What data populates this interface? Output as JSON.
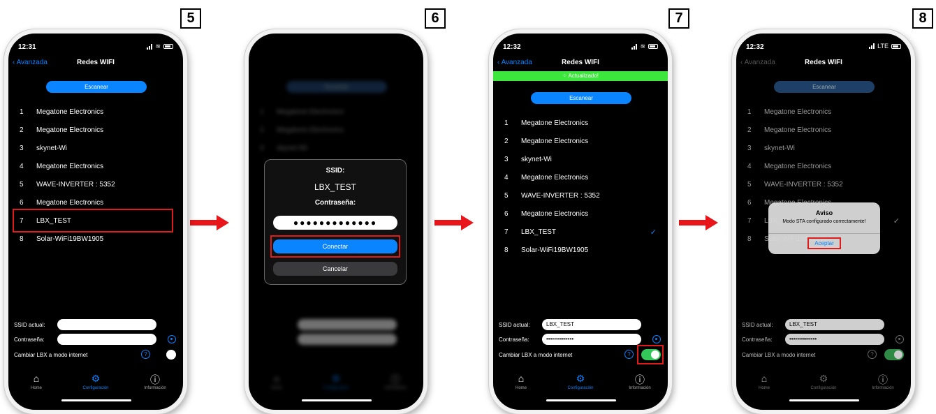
{
  "steps": [
    "5",
    "6",
    "7",
    "8"
  ],
  "status_bar": {
    "time_5": "12:31",
    "time_7": "12:32",
    "time_8": "12:32",
    "lte": "LTE"
  },
  "nav": {
    "back_label": "Avanzada",
    "title": "Redes WIFI"
  },
  "banner": {
    "text": "Actualizado!"
  },
  "scan_button": "Escanear",
  "networks": [
    {
      "num": "1",
      "name": "Megatone Electronics"
    },
    {
      "num": "2",
      "name": "Megatone Electronics"
    },
    {
      "num": "3",
      "name": "skynet-Wi"
    },
    {
      "num": "4",
      "name": "Megatone Electronics"
    },
    {
      "num": "5",
      "name": "WAVE-INVERTER : 5352"
    },
    {
      "num": "6",
      "name": "Megatone Electronics"
    },
    {
      "num": "7",
      "name": "LBX_TEST"
    },
    {
      "num": "8",
      "name": "Solar-WiFi19BW1905"
    }
  ],
  "form": {
    "ssid_label": "SSID actual:",
    "password_label": "Contraseña:",
    "internet_label": "Cambiar LBX a modo internet",
    "ssid_value": "LBX_TEST",
    "password_mask": "••••••••••••••"
  },
  "dialog": {
    "ssid_label": "SSID:",
    "ssid_value": "LBX_TEST",
    "password_label": "Contraseña:",
    "password_mask": "●●●●●●●●●●●●●",
    "connect": "Conectar",
    "cancel": "Cancelar"
  },
  "alert": {
    "title": "Aviso",
    "message": "Modo STA configurado correctamente!",
    "accept": "Aceptar"
  },
  "tabs": {
    "home": "Home",
    "config": "Configuración",
    "info": "Información"
  },
  "colors": {
    "accent": "#0a84ff",
    "success": "#3de63d",
    "toggle_on": "#34c759",
    "highlight": "#e01b1b",
    "arrow": "#e8161b"
  }
}
